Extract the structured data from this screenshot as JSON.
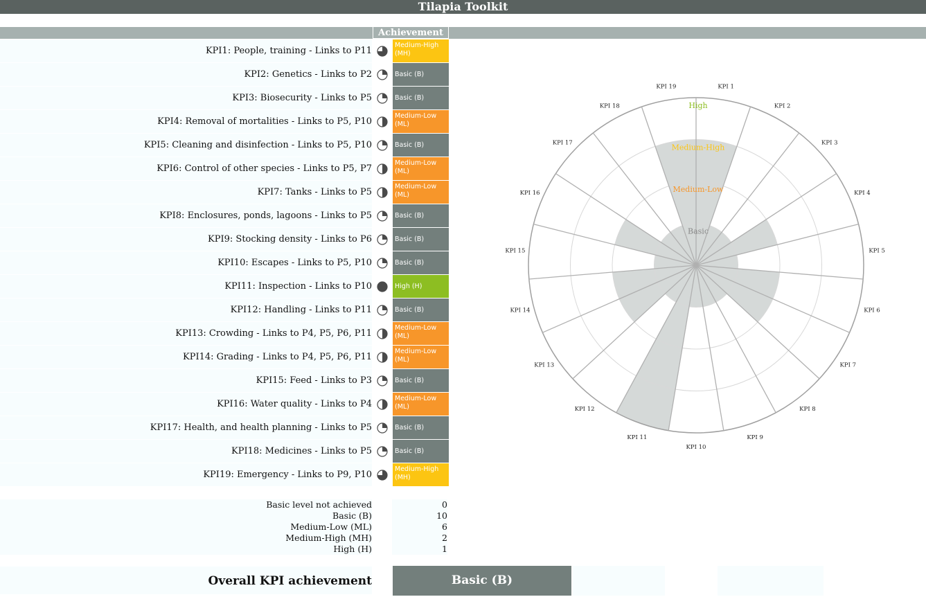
{
  "app": {
    "title": "Tilapia Toolkit"
  },
  "table": {
    "achievement_header": "Achievement"
  },
  "level_colors": {
    "Basic": "#737f7c",
    "Medium-Low": "#f7962a",
    "Medium-High": "#fcc512",
    "High": "#8dbe22"
  },
  "kpis": [
    {
      "label": "KPI1: People, training - Links to P11",
      "badge_line1": "Medium-High",
      "badge_line2": "(MH)",
      "level": "Medium-High",
      "fill_fraction": 0.75
    },
    {
      "label": "KPI2: Genetics - Links to P2",
      "badge_line1": "Basic (B)",
      "badge_line2": "",
      "level": "Basic",
      "fill_fraction": 0.25
    },
    {
      "label": "KPI3: Biosecurity  - Links to P5",
      "badge_line1": "Basic (B)",
      "badge_line2": "",
      "level": "Basic",
      "fill_fraction": 0.25
    },
    {
      "label": "KPI4: Removal of mortalities - Links to P5, P10",
      "badge_line1": "Medium-Low",
      "badge_line2": "(ML)",
      "level": "Medium-Low",
      "fill_fraction": 0.5
    },
    {
      "label": "KPI5: Cleaning and disinfection - Links to P5, P10",
      "badge_line1": "Basic (B)",
      "badge_line2": "",
      "level": "Basic",
      "fill_fraction": 0.25
    },
    {
      "label": "KPI6: Control of other species - Links to P5, P7",
      "badge_line1": "Medium-Low",
      "badge_line2": "(ML)",
      "level": "Medium-Low",
      "fill_fraction": 0.5
    },
    {
      "label": "KPI7: Tanks  - Links to P5",
      "badge_line1": "Medium-Low",
      "badge_line2": "(ML)",
      "level": "Medium-Low",
      "fill_fraction": 0.5
    },
    {
      "label": "KPI8: Enclosures, ponds, lagoons    - Links to P5",
      "badge_line1": "Basic (B)",
      "badge_line2": "",
      "level": "Basic",
      "fill_fraction": 0.25
    },
    {
      "label": "KPI9: Stocking density - Links to P6",
      "badge_line1": "Basic (B)",
      "badge_line2": "",
      "level": "Basic",
      "fill_fraction": 0.25
    },
    {
      "label": "KPI10: Escapes - Links to P5, P10",
      "badge_line1": "Basic (B)",
      "badge_line2": "",
      "level": "Basic",
      "fill_fraction": 0.25
    },
    {
      "label": "KPI11: Inspection - Links to P10",
      "badge_line1": "High (H)",
      "badge_line2": "",
      "level": "High",
      "fill_fraction": 1.0
    },
    {
      "label": "KPI12: Handling  - Links to P11",
      "badge_line1": "Basic (B)",
      "badge_line2": "",
      "level": "Basic",
      "fill_fraction": 0.25
    },
    {
      "label": "KPI13: Crowding - Links to P4, P5, P6, P11",
      "badge_line1": "Medium-Low",
      "badge_line2": "(ML)",
      "level": "Medium-Low",
      "fill_fraction": 0.5
    },
    {
      "label": "KPI14: Grading - Links to P4, P5, P6, P11",
      "badge_line1": "Medium-Low",
      "badge_line2": "(ML)",
      "level": "Medium-Low",
      "fill_fraction": 0.5
    },
    {
      "label": "KPI15: Feed - Links to P3",
      "badge_line1": "Basic (B)",
      "badge_line2": "",
      "level": "Basic",
      "fill_fraction": 0.25
    },
    {
      "label": "KPI16: Water quality - Links to P4",
      "badge_line1": "Medium-Low",
      "badge_line2": "(ML)",
      "level": "Medium-Low",
      "fill_fraction": 0.5
    },
    {
      "label": "KPI17: Health, and health planning - Links to P5",
      "badge_line1": "Basic (B)",
      "badge_line2": "",
      "level": "Basic",
      "fill_fraction": 0.25
    },
    {
      "label": "KPI18: Medicines - Links to P5",
      "badge_line1": "Basic (B)",
      "badge_line2": "",
      "level": "Basic",
      "fill_fraction": 0.25
    },
    {
      "label": "KPI19: Emergency - Links to P9, P10",
      "badge_line1": "Medium-High",
      "badge_line2": "(MH)",
      "level": "Medium-High",
      "fill_fraction": 0.75
    }
  ],
  "summary": [
    {
      "label": "Basic level not achieved",
      "value": "0"
    },
    {
      "label": "Basic (B)",
      "value": "10"
    },
    {
      "label": "Medium-Low (ML)",
      "value": "6"
    },
    {
      "label": "Medium-High (MH)",
      "value": "2"
    },
    {
      "label": "High (H)",
      "value": "1"
    }
  ],
  "overall": {
    "label": "Overall KPI achievement",
    "value": "Basic (B)"
  },
  "chart_data": {
    "type": "radar",
    "title": "",
    "categories": [
      "KPI 1",
      "KPI 2",
      "KPI 3",
      "KPI 4",
      "KPI 5",
      "KPI 6",
      "KPI 7",
      "KPI 8",
      "KPI 9",
      "KPI 10",
      "KPI 11",
      "KPI 12",
      "KPI 13",
      "KPI 14",
      "KPI 15",
      "KPI 16",
      "KPI 17",
      "KPI 18",
      "KPI 19"
    ],
    "levels": [
      "Basic",
      "Medium-Low",
      "Medium-High",
      "High"
    ],
    "level_label_colors": [
      "#888888",
      "#f7962a",
      "#fcc512",
      "#8dbe22"
    ],
    "values": [
      3,
      1,
      1,
      2,
      1,
      2,
      2,
      1,
      1,
      1,
      4,
      1,
      2,
      2,
      1,
      2,
      1,
      1,
      3
    ],
    "ylim": [
      0,
      4
    ],
    "fill_color": "#d5d9d8",
    "gridlines": true
  }
}
